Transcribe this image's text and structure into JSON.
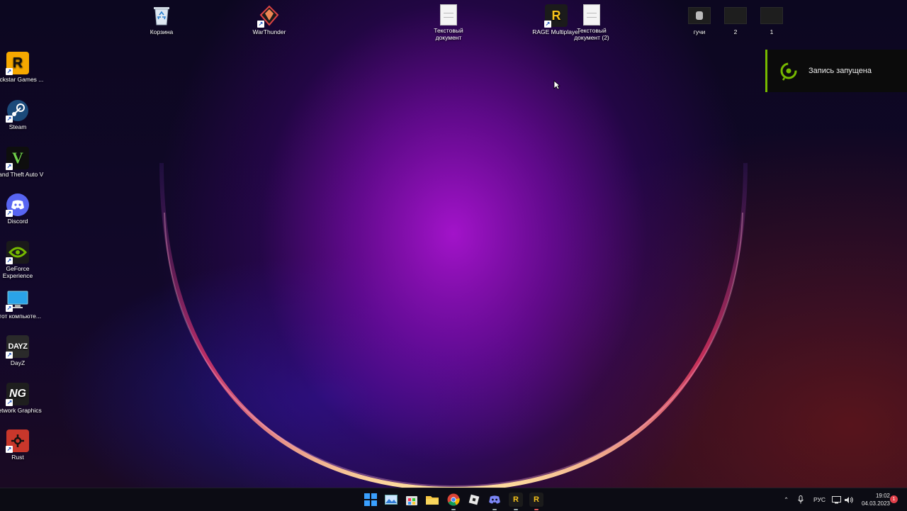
{
  "desktop": {
    "top_icons": [
      {
        "name": "recycle-bin",
        "label": "Корзина"
      },
      {
        "name": "warthunder",
        "label": "WarThunder"
      },
      {
        "name": "text-document-1",
        "label": "Текстовый документ"
      },
      {
        "name": "rage-multiplayer",
        "label": "RAGE Multiplayer"
      },
      {
        "name": "text-document-2",
        "label": "Текстовый документ (2)"
      },
      {
        "name": "folder-guchi",
        "label": "гучи"
      },
      {
        "name": "folder-2",
        "label": "2"
      },
      {
        "name": "folder-1",
        "label": "1"
      }
    ],
    "left_icons": [
      {
        "name": "rockstar-games",
        "label": "Rockstar Games ...",
        "glyph": "R"
      },
      {
        "name": "steam",
        "label": "Steam",
        "glyph": ""
      },
      {
        "name": "gta-v",
        "label": "Grand Theft Auto V",
        "glyph": "V"
      },
      {
        "name": "discord",
        "label": "Discord",
        "glyph": ""
      },
      {
        "name": "geforce-experience",
        "label": "GeForce Experience",
        "glyph": ""
      },
      {
        "name": "this-pc",
        "label": "Этот компьюте...",
        "glyph": ""
      },
      {
        "name": "dayz",
        "label": "DayZ",
        "glyph": "DAYZ"
      },
      {
        "name": "network-graphics",
        "label": "Network Graphics",
        "glyph": "NG"
      },
      {
        "name": "rust",
        "label": "Rust",
        "glyph": ""
      }
    ]
  },
  "notification": {
    "text": "Запись запущена",
    "accent": "#76b900"
  },
  "taskbar": {
    "apps": [
      "start-icon",
      "photos-icon",
      "store-icon",
      "file-explorer-icon",
      "chrome-icon",
      "roblox-icon",
      "discord-icon",
      "rage-icon",
      "rage-icon-2"
    ],
    "language": "РУС",
    "time": "19:02",
    "date": "04.03.2023",
    "notification_count": "1"
  }
}
